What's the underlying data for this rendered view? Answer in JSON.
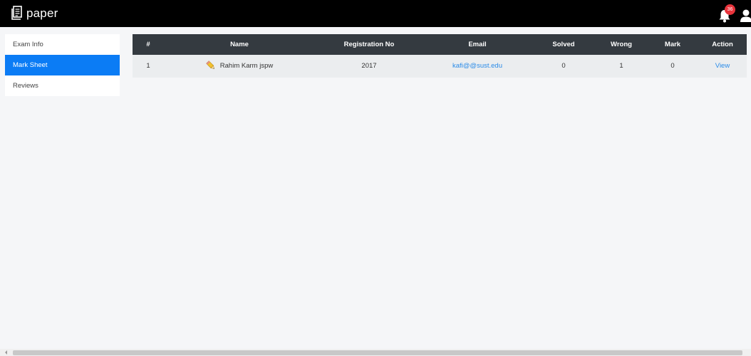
{
  "navbar": {
    "brand": "paper",
    "notification_count": "36"
  },
  "sidebar": {
    "items": [
      {
        "label": "Exam Info",
        "active": false
      },
      {
        "label": "Mark Sheet",
        "active": true
      },
      {
        "label": "Reviews",
        "active": false
      }
    ]
  },
  "table": {
    "headers": [
      "#",
      "Name",
      "Registration No",
      "Email",
      "Solved",
      "Wrong",
      "Mark",
      "Action"
    ],
    "rows": [
      {
        "index": "1",
        "name": "Rahim Karm jspw",
        "registration_no": "2017",
        "email": "kafi@@sust.edu",
        "solved": "0",
        "wrong": "1",
        "mark": "0",
        "action": "View"
      }
    ]
  },
  "colors": {
    "navbar": "#000000",
    "table_header": "#343a40",
    "active_item": "#0b7cf5",
    "link": "#2a8be8",
    "badge": "#e8343c",
    "page_background": "#f5f6f8"
  }
}
